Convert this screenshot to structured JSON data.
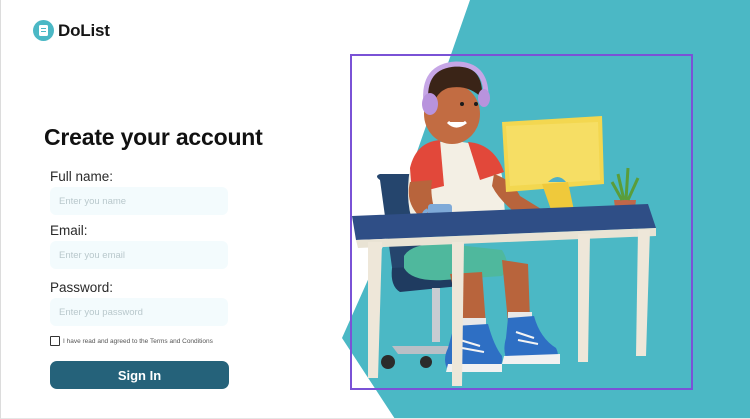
{
  "brand": {
    "name": "DoList",
    "icon": "notepad-icon",
    "accent": "#4bb8c5"
  },
  "form": {
    "title": "Create your account",
    "full_name": {
      "label": "Full name:",
      "placeholder": "Enter you name",
      "value": ""
    },
    "email": {
      "label": "Email:",
      "placeholder": "Enter you email",
      "value": ""
    },
    "password": {
      "label": "Password:",
      "placeholder": "Enter you password",
      "value": ""
    },
    "terms": {
      "label": "I have read and agreed to the Terms and Conditions",
      "checked": false
    },
    "submit_label": "Sign In"
  },
  "colors": {
    "teal": "#4bb8c5",
    "button": "#25627a",
    "input_bg": "#f3fbfd",
    "frame": "#7a52d6"
  }
}
